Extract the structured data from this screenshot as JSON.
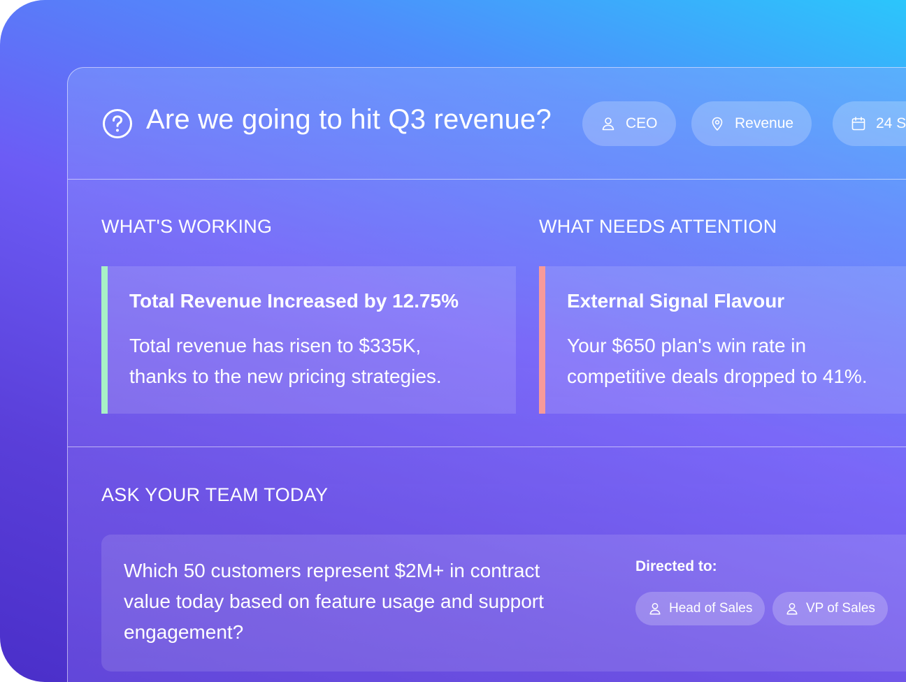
{
  "header": {
    "title": "Are we going to hit Q3 revenue?",
    "chips": [
      {
        "label": "CEO",
        "icon": "user-icon"
      },
      {
        "label": "Revenue",
        "icon": "location-pin-icon"
      },
      {
        "label": "24 S",
        "icon": "calendar-icon"
      }
    ]
  },
  "working": {
    "label": "WHAT'S WORKING",
    "card": {
      "title": "Total Revenue Increased by 12.75%",
      "line1": "Total revenue has risen to $335K,",
      "line2": "thanks to the new  pricing strategies.",
      "accent": "#a8f0c6"
    }
  },
  "attention": {
    "label": "WHAT NEEDS ATTENTION",
    "card": {
      "title": "External Signal Flavour",
      "line1": "Your $650 plan's win rate in",
      "line2": "competitive deals dropped to 41%.",
      "accent": "#f79a9a"
    }
  },
  "ask": {
    "label": "ASK YOUR TEAM TODAY",
    "question_line1": "Which 50 customers represent $2M+ in contract",
    "question_line2": "value today based on feature usage and support",
    "question_line3": "engagement?",
    "directed_label": "Directed to:",
    "assignees": [
      {
        "label": "Head of Sales",
        "icon": "user-icon"
      },
      {
        "label": "VP of Sales",
        "icon": "user-icon"
      }
    ]
  }
}
